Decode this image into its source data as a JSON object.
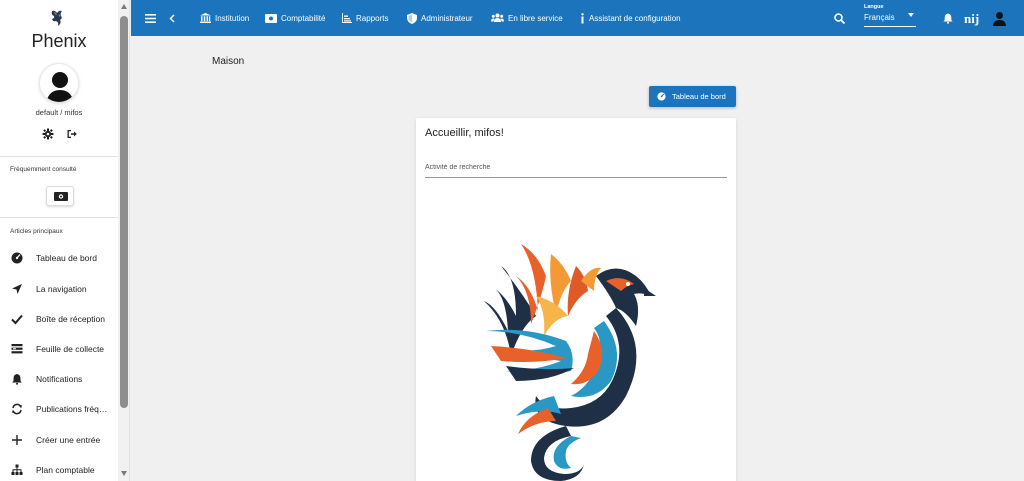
{
  "brand": {
    "name": "Phenix"
  },
  "user": {
    "label": "default / mifos"
  },
  "sidebar": {
    "frequent_title": "Fréquemment consulté",
    "main_title": "Articles principaux",
    "items": [
      {
        "label": "Tableau de bord",
        "icon": "dashboard-icon"
      },
      {
        "label": "La navigation",
        "icon": "navigation-arrow-icon"
      },
      {
        "label": "Boîte de réception",
        "icon": "checkmark-icon"
      },
      {
        "label": "Feuille de collecte",
        "icon": "collection-sheet-icon"
      },
      {
        "label": "Notifications",
        "icon": "bell-icon"
      },
      {
        "label": "Publications fréquentes",
        "icon": "refresh-icon"
      },
      {
        "label": "Créer une entrée",
        "icon": "plus-icon"
      },
      {
        "label": "Plan comptable",
        "icon": "sitemap-icon"
      }
    ]
  },
  "topbar": {
    "institution": "Institution",
    "comptabilite": "Comptabilité",
    "rapports": "Rapports",
    "administrateur": "Administrateur",
    "libre_service": "En libre service",
    "assistant": "Assistant de configuration",
    "language_label": "Langue",
    "language_value": "Français",
    "user_initials": "nij"
  },
  "main": {
    "page_title": "Maison",
    "dashboard_button": "Tableau de bord",
    "welcome": "Accueillir, mifos!",
    "search_placeholder": "Activité de recherche"
  },
  "colors": {
    "primary": "#1b74bc",
    "background": "#f0f0f0"
  }
}
